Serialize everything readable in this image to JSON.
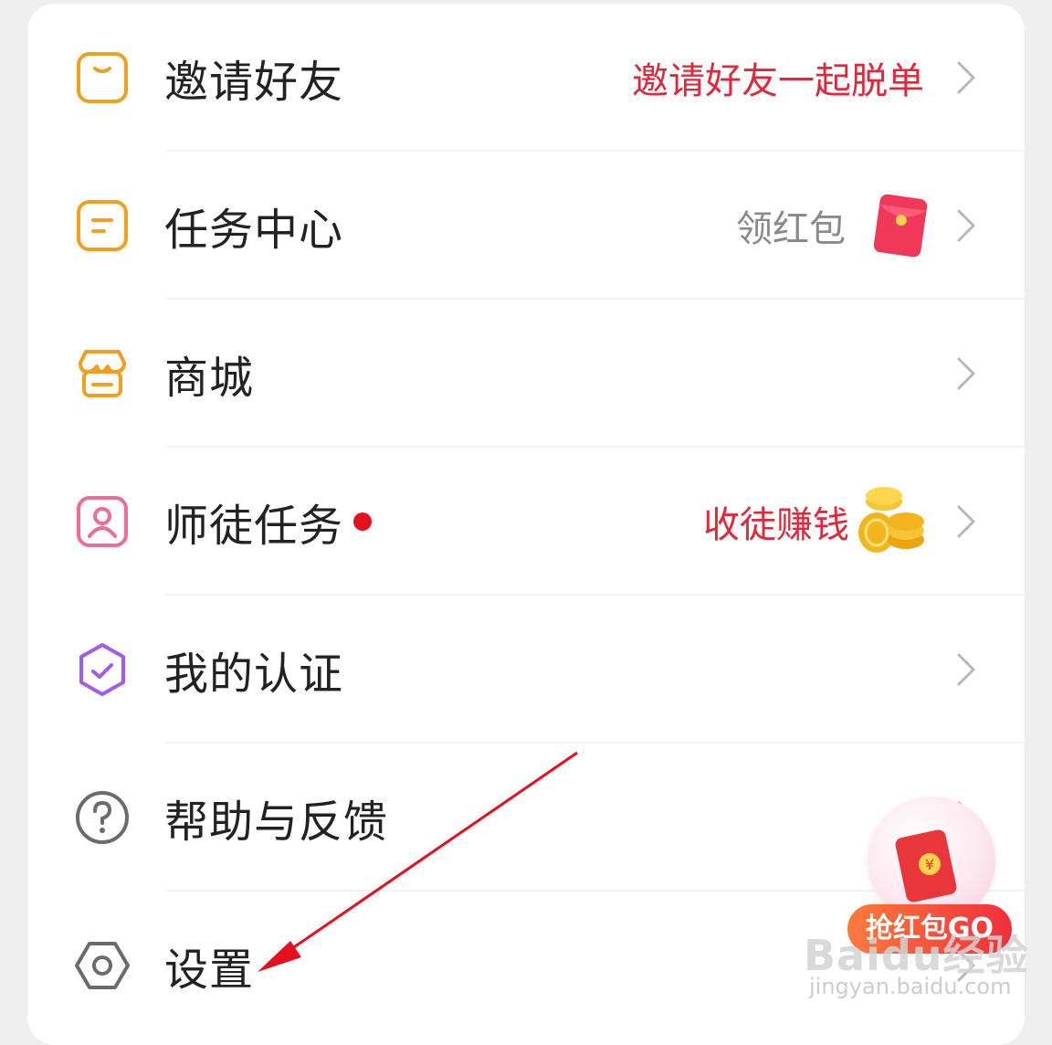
{
  "menu": {
    "invite": {
      "label": "邀请好友",
      "hint": "邀请好友一起脱单"
    },
    "tasks": {
      "label": "任务中心",
      "hint": "领红包"
    },
    "mall": {
      "label": "商城"
    },
    "mentor": {
      "label": "师徒任务",
      "hint": "收徒赚钱"
    },
    "verify": {
      "label": "我的认证"
    },
    "help": {
      "label": "帮助与反馈"
    },
    "settings": {
      "label": "设置"
    }
  },
  "float_badge": {
    "label": "抢红包GO"
  },
  "watermark": {
    "brand": "Baidu经验",
    "url": "jingyan.baidu.com"
  },
  "colors": {
    "accent_orange": "#f0a020",
    "accent_pink": "#f06a9a",
    "accent_purple": "#a15bf0",
    "hint_red": "#e0283a",
    "hint_gray": "#8a8a8a",
    "annotation_arrow": "#e5101e"
  }
}
